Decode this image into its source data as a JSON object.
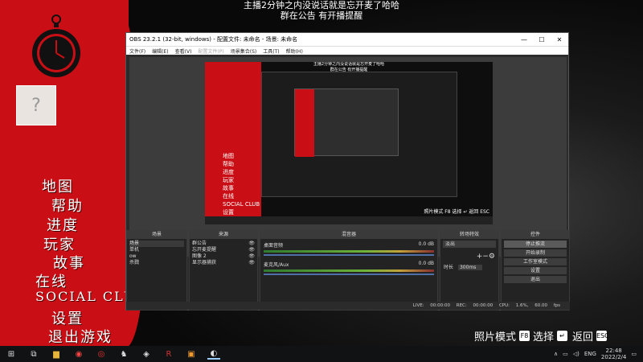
{
  "stream_top": {
    "line1": "主播2分钟之内没说话就是忘开麦了哈哈",
    "line2": "群在公告 有开播提醒"
  },
  "game_menu": [
    "地图",
    "帮助",
    "进度",
    "玩家",
    "故事",
    "在线",
    "SOCIAL CLUB",
    "设置",
    "退出游戏"
  ],
  "bottom_hints": [
    {
      "label": "照片模式",
      "key": "F8"
    },
    {
      "label": "选择",
      "key": "↵"
    },
    {
      "label": "返回",
      "key": "ESC"
    }
  ],
  "obs": {
    "title": "OBS 23.2.1 (32-bit, windows) - 配置文件: 未命名 - 场景: 未命名",
    "menus": [
      "文件(F)",
      "编辑(E)",
      "查看(V)",
      "配置文件(P)",
      "场景集合(S)",
      "工具(T)",
      "帮助(H)"
    ],
    "preview": {
      "caption1": "主播2分钟之内没说话就是忘开麦了哈哈",
      "caption2": "群在公告 有开播提醒",
      "menu": "地图\n帮助\n进度\n玩家\n故事\n在线\nSOCIAL CLUB\n设置\n退出游戏",
      "hint": "照片模式 F8   选择 ↵  返回 ESC"
    },
    "docks": {
      "scenes": {
        "title": "场景",
        "items": [
          "场景",
          "单机",
          "ow",
          "杀戮"
        ]
      },
      "sources": {
        "title": "来源",
        "items": [
          "群公告",
          "忘开麦提醒",
          "图像 2",
          "显示器捕获"
        ]
      },
      "mixer": {
        "title": "混音器",
        "tracks": [
          {
            "name": "桌面音频",
            "db": "0.0 dB"
          },
          {
            "name": "麦克风/Aux",
            "db": "0.0 dB"
          }
        ]
      },
      "transitions": {
        "title": "转场特效",
        "selected": "淡出",
        "duration_label": "时长",
        "duration": "300ms"
      },
      "controls": {
        "title": "控件",
        "buttons": [
          "停止推流",
          "开始录制",
          "工作室模式",
          "设置",
          "退出"
        ]
      }
    },
    "status": "LIVE: 00:00:00   REC: 00:00:00   CPU: 1.6%, 60.00 fps"
  },
  "taskbar": {
    "lang": "ENG",
    "time": "22:48",
    "date": "2022/2/4"
  }
}
